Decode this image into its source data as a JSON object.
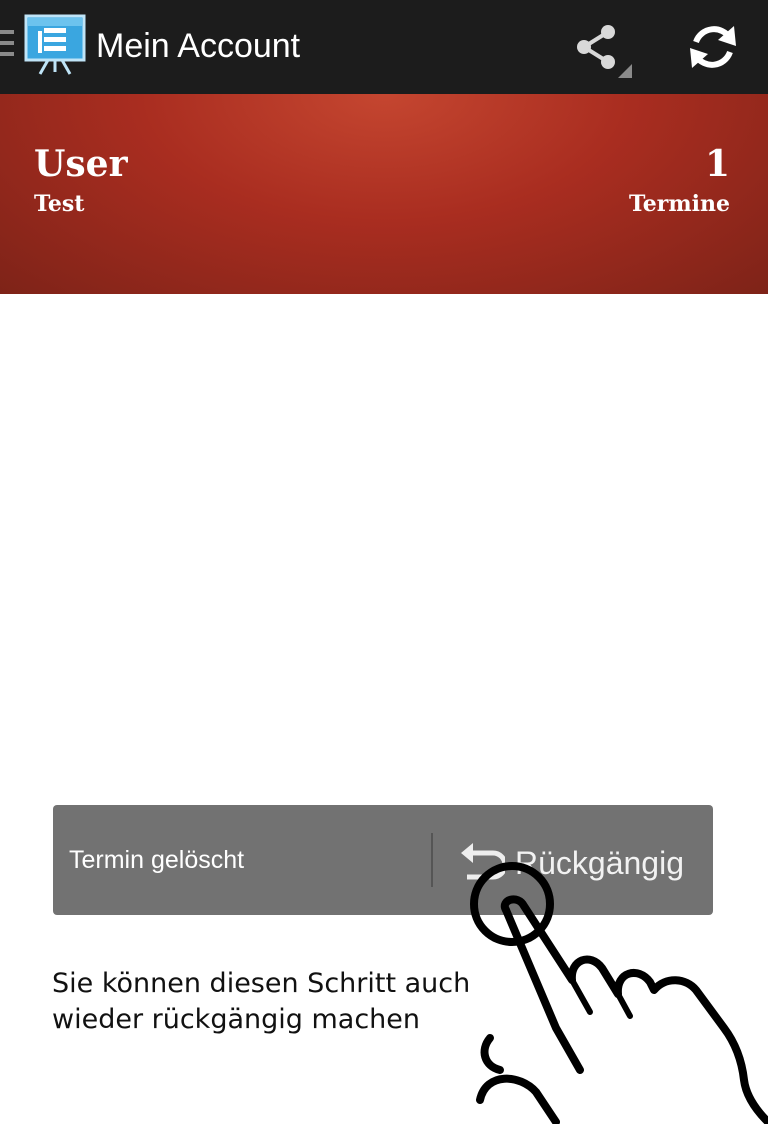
{
  "action_bar": {
    "title": "Mein Account",
    "icons": [
      "menu-icon",
      "presentation-board-icon",
      "share-icon",
      "refresh-icon"
    ],
    "background": "#1c1c1c"
  },
  "header": {
    "user_name": "User",
    "user_subtitle": "Test",
    "count": "1",
    "count_label": "Termine",
    "accent": "#a92d20"
  },
  "snackbar": {
    "message": "Termin gelöscht",
    "action_label": "Rückgängig",
    "action_icon": "undo-icon",
    "background": "#727272"
  },
  "hint": {
    "text": "Sie können diesen Schritt auch wieder rückgängig machen"
  }
}
